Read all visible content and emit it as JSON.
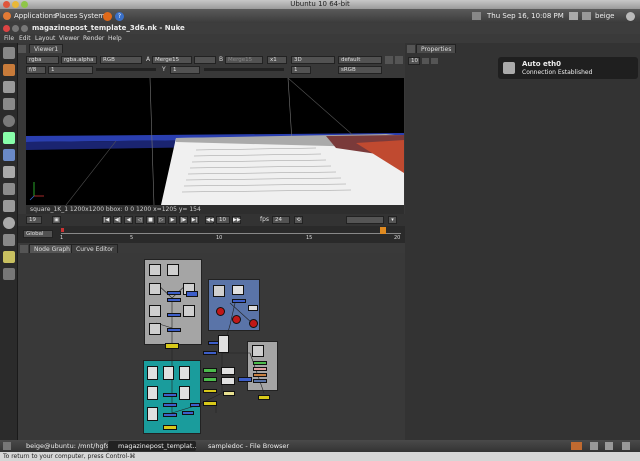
{
  "vm_window": {
    "title": "Ubuntu 10 64-bit"
  },
  "gnome_panel": {
    "applications": "Applications",
    "places": "Places",
    "system": "System",
    "clock": "Thu Sep 16, 10:08 PM",
    "user": "beige"
  },
  "nuke": {
    "title": "magazinepost_template_3d6.nk - Nuke",
    "menu": [
      "File",
      "Edit",
      "Layout",
      "Viewer",
      "Render",
      "Help"
    ]
  },
  "viewer": {
    "tab": "Viewer1",
    "channels": "rgba",
    "alpha": "rgba.alpha",
    "colorspace": "RGB",
    "a_label": "A",
    "a_input": "Merge15",
    "b_label": "B",
    "b_input": "Merge15",
    "zoom": "x1",
    "view_mode": "3D",
    "lut": "default",
    "frame_range": "f/8",
    "gain": "1",
    "gamma_label": "Y",
    "gamma": "1",
    "exposure": "1",
    "display_lut": "sRGB",
    "status": "square_1K_1 1200x1200  bbox: 0 0 1200    x=1205 y= 154"
  },
  "transport": {
    "frame": "19",
    "step": "10",
    "fps_label": "fps",
    "fps": "24"
  },
  "timeline": {
    "range_mode": "Global",
    "ticks": [
      "1",
      "5",
      "10",
      "15",
      "20"
    ],
    "playhead_frame": 19
  },
  "node_graph": {
    "tabs": [
      "Node Graph",
      "Curve Editor"
    ]
  },
  "properties": {
    "tab": "Properties",
    "count": "10"
  },
  "notification": {
    "title": "Auto eth0",
    "message": "Connection Established"
  },
  "taskbar": {
    "items": [
      "beige@ubuntu: /mnt/hgfs",
      "magazinepost_templat...",
      "sampledoc - File Browser"
    ]
  },
  "vm_status": "To return to your computer, press Control-⌘",
  "colors": {
    "node_graph_bg": "#393939",
    "backdrop_gray": "#a5a5a5",
    "backdrop_teal": "#1a9c9c",
    "backdrop_blue": "#5a74a8",
    "merge_node": "#3d5ec9",
    "read_node": "#cfcfcf",
    "viewer_node": "#d8c91a",
    "red_node": "#c01818"
  }
}
